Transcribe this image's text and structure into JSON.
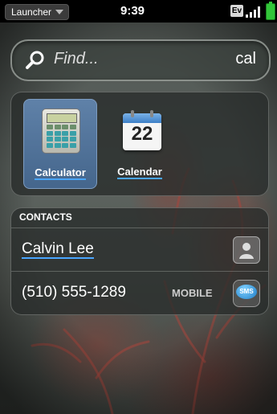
{
  "status_bar": {
    "app_menu_label": "Launcher",
    "time": "9:39",
    "network_badge": "Ev",
    "signal_icon": "signal-bars-icon",
    "battery_icon": "battery-icon",
    "battery_color": "#33c53a"
  },
  "search": {
    "placeholder": "Find...",
    "query": "cal",
    "icon": "magnifier-icon"
  },
  "apps": [
    {
      "label": "Calculator",
      "icon": "calculator-icon",
      "selected": true
    },
    {
      "label": "Calendar",
      "icon": "calendar-icon",
      "date_number": "22",
      "selected": false
    }
  ],
  "contacts": {
    "header": "CONTACTS",
    "name": "Calvin Lee",
    "phone": "(510) 555-1289",
    "phone_type": "MOBILE",
    "sms_label": "SMS"
  },
  "colors": {
    "highlight_underline": "#4aa6ff",
    "selected_tile": "#5f81a8"
  }
}
